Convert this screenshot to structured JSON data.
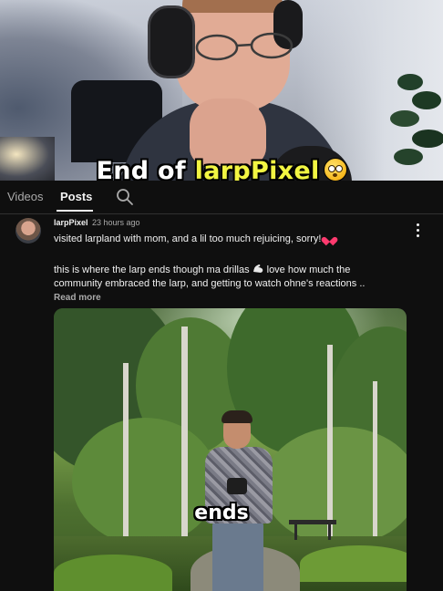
{
  "overlay": {
    "top_caption_prefix": "End of ",
    "top_caption_highlight": "larpPixel",
    "top_caption_emoji": "flushed-face-emoji",
    "bottom_caption": "ends",
    "highlight_color": "#f2f542"
  },
  "tabs": [
    {
      "label": "Videos",
      "active": false
    },
    {
      "label": "Posts",
      "active": true
    }
  ],
  "search_icon": "search-icon",
  "post": {
    "author": "larpPixel",
    "time": "23 hours ago",
    "line1": "visited larpland with mom, and a lil too much rejuicing, sorry!",
    "line2a": "this is where the larp ends though ma drillas",
    "line2b": "love how much the",
    "line3": "community embraced the larp, and getting to watch ohne's reactions ..",
    "read_more": "Read more",
    "emoji_heart": "pink-heart-emoji",
    "emoji_flex": "flexed-biceps-emoji"
  },
  "colors": {
    "background": "#0f0f0f",
    "text_primary": "#f1f1f1",
    "text_secondary": "#aaaaaa"
  }
}
